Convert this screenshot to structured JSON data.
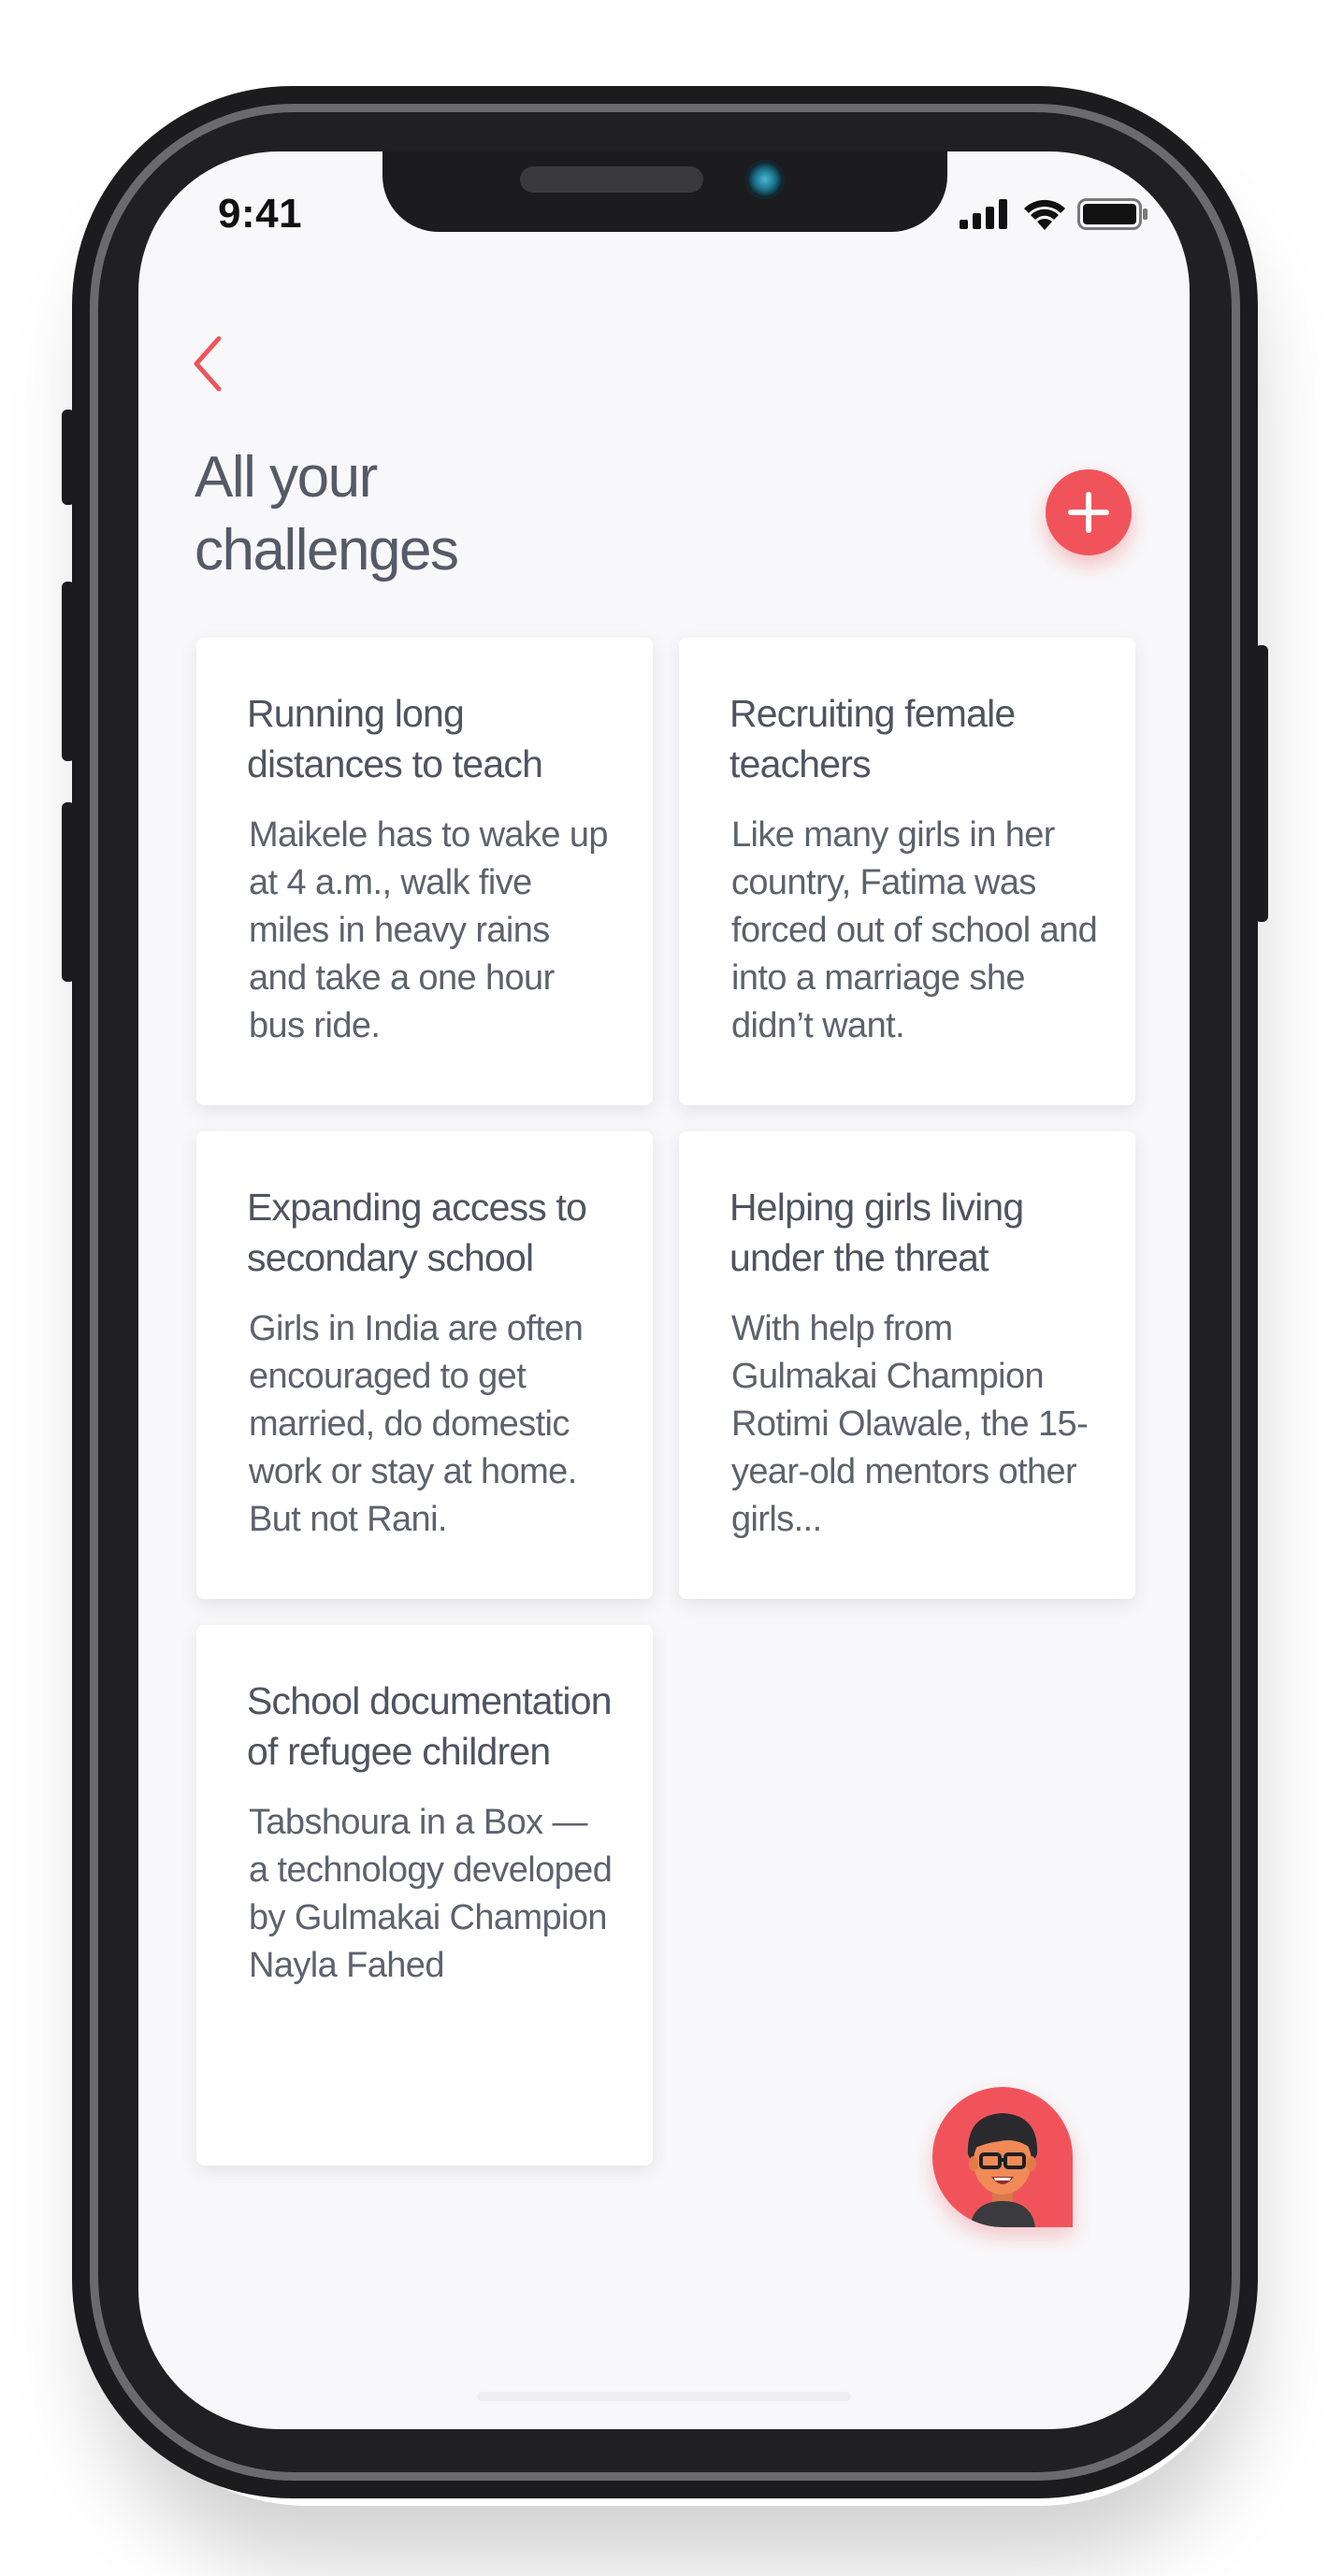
{
  "status_bar": {
    "time": "9:41",
    "icons": [
      "cellular-signal-icon",
      "wifi-icon",
      "battery-icon"
    ]
  },
  "header": {
    "back_icon": "chevron-left-icon",
    "title_line1": "All your",
    "title_line2": "challenges",
    "add_icon": "plus-icon"
  },
  "challenges": [
    {
      "title": "Running long distances to teach",
      "description": "Maikele has to wake up at 4 a.m., walk five miles in heavy rains and take a one hour bus ride."
    },
    {
      "title": "Recruiting female teachers",
      "description": "Like many girls in her country, Fatima was forced out of school and into a marriage she didn’t want."
    },
    {
      "title": "Expanding access to secondary school",
      "description": "Girls in India are often encouraged to get married, do domestic work or stay at home. But not Rani."
    },
    {
      "title": "Helping girls living under the threat",
      "description": "With help from Gulmakai Champion Rotimi Olawale, the 15-year-old mentors other girls..."
    },
    {
      "title": "School documentation of refugee children",
      "description": "Tabshoura in a Box — a technology developed by Gulmakai Champion Nayla Fahed"
    }
  ],
  "assistant": {
    "icon": "assistant-avatar-icon"
  },
  "colors": {
    "accent": "#f0545a",
    "background": "#f8f8fa",
    "card": "#ffffff",
    "title_text": "#555a66",
    "body_text": "#5d626d"
  }
}
